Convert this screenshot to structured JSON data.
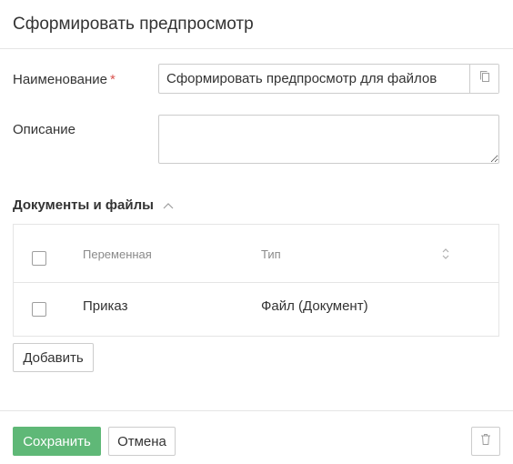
{
  "dialog": {
    "title": "Сформировать предпросмотр"
  },
  "form": {
    "name_label": "Наименование",
    "required_mark": "*",
    "name_value": "Сформировать предпросмотр для файлов",
    "description_label": "Описание",
    "description_value": ""
  },
  "documents": {
    "section_title": "Документы и файлы",
    "columns": [
      "Переменная",
      "Тип"
    ],
    "rows": [
      {
        "variable": "Приказ",
        "type": "Файл (Документ)",
        "checked": false
      }
    ],
    "add_label": "Добавить"
  },
  "footer": {
    "save_label": "Сохранить",
    "cancel_label": "Отмена"
  },
  "icons": [
    "copy-icon",
    "chevron-up-icon",
    "sort-icon",
    "trash-icon"
  ],
  "colors": {
    "primary": "#5fb877",
    "required": "#d9534f",
    "border": "#cccccc",
    "divider": "#e5e5e5"
  }
}
